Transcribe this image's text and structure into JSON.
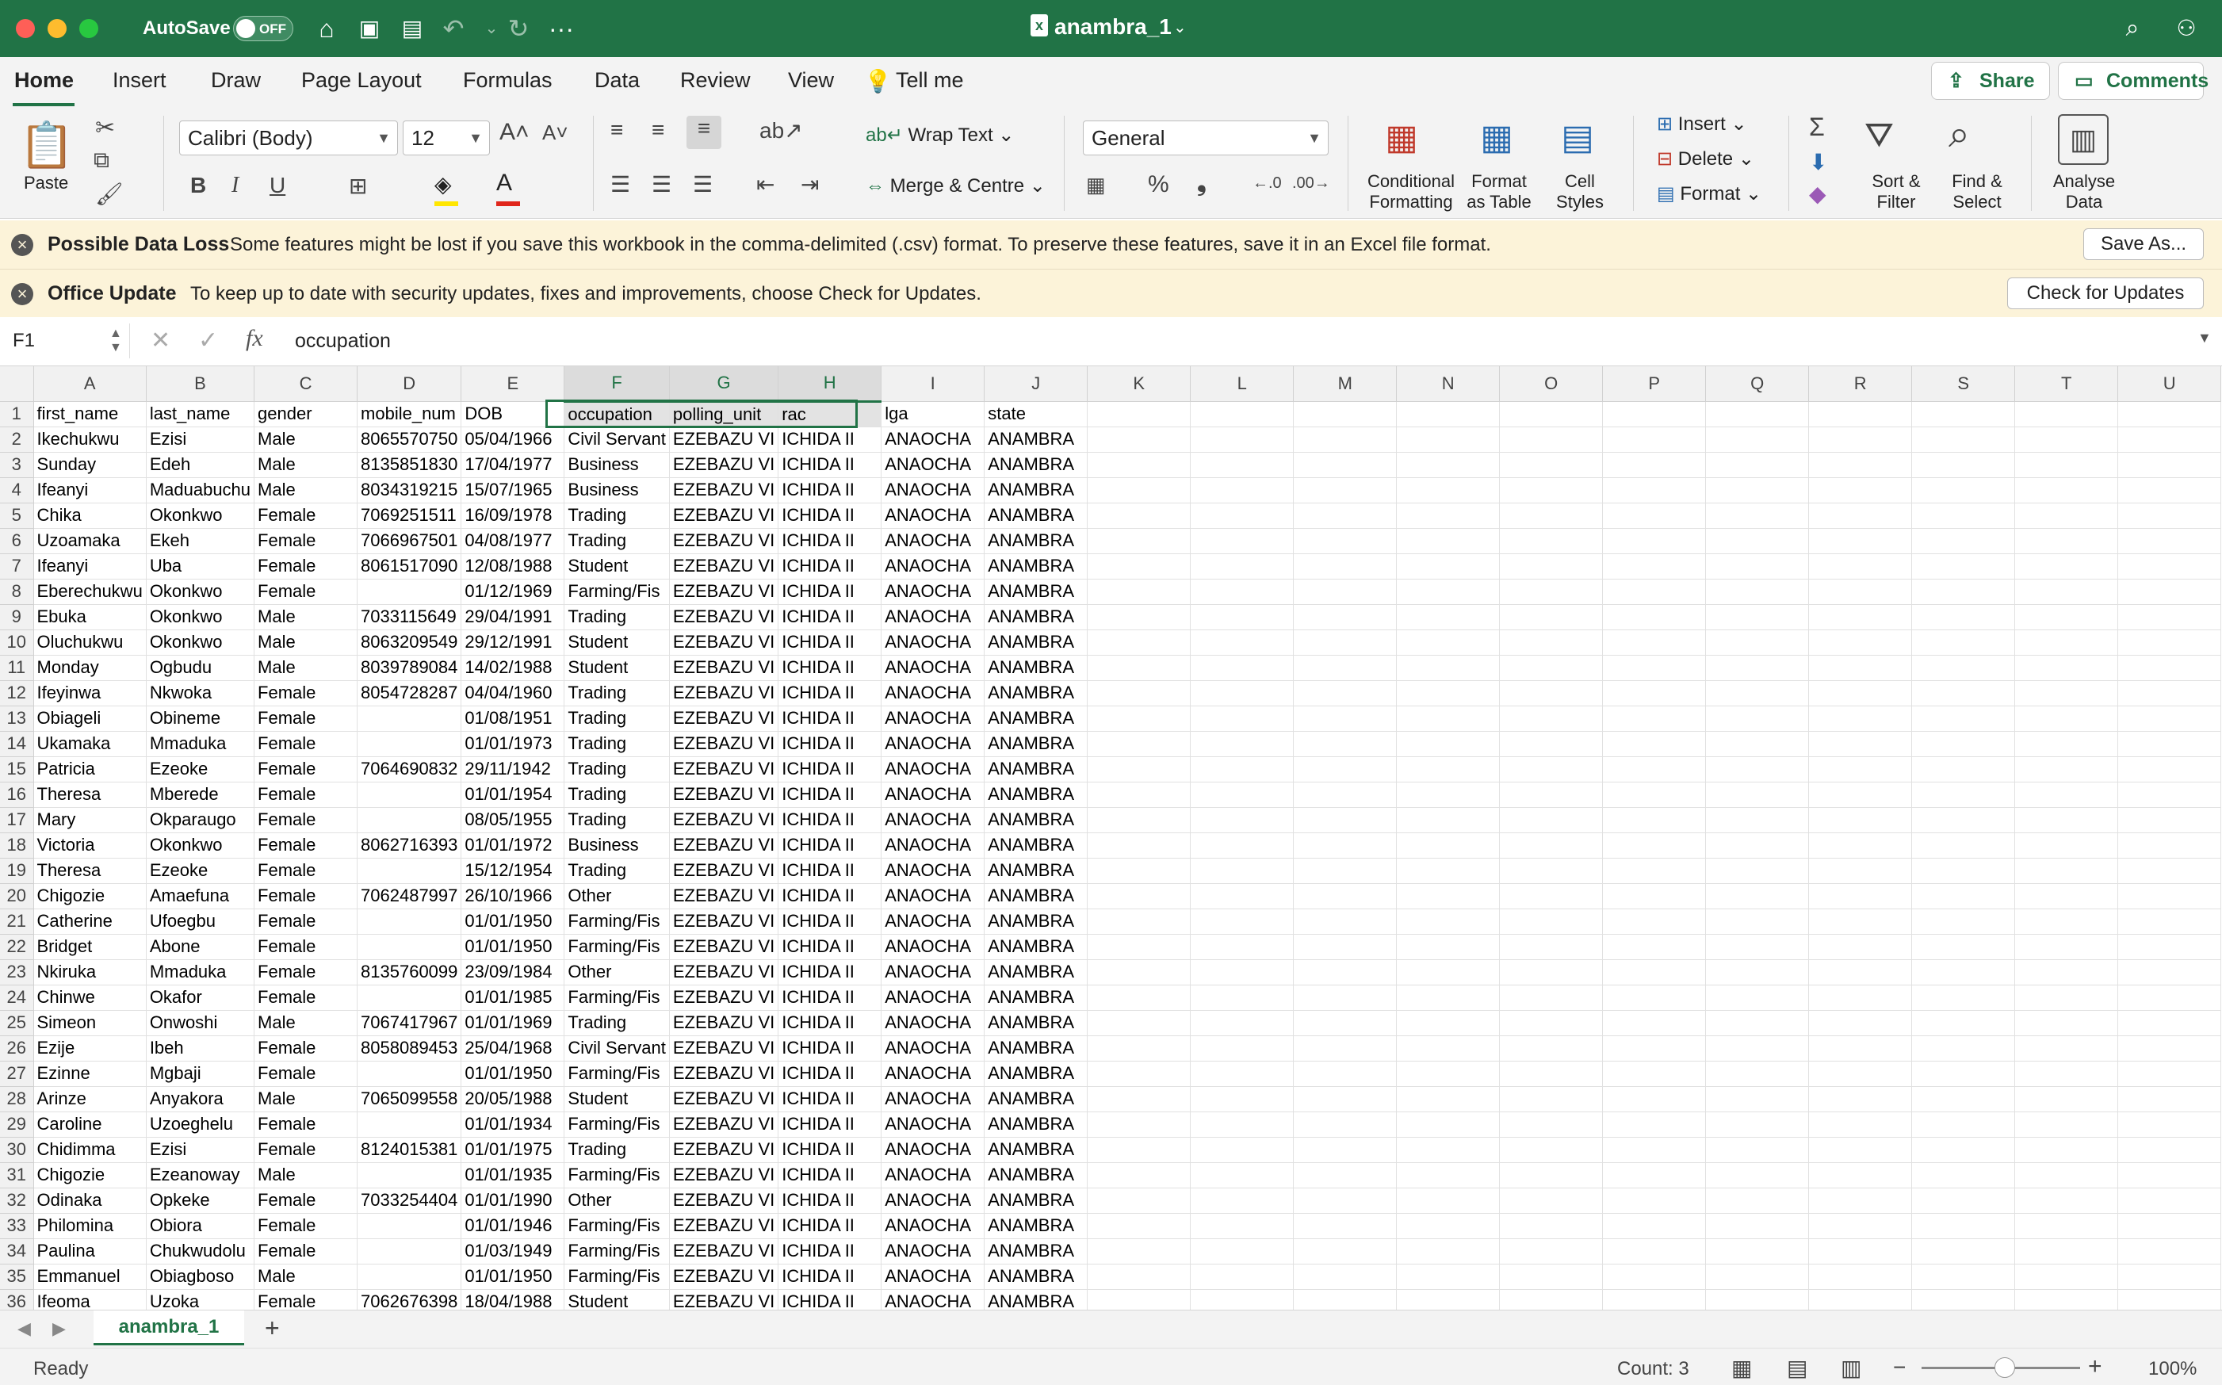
{
  "titlebar": {
    "autosave_label": "AutoSave",
    "autosave_state": "OFF",
    "doc_title": "anambra_1"
  },
  "tabs": [
    "Home",
    "Insert",
    "Draw",
    "Page Layout",
    "Formulas",
    "Data",
    "Review",
    "View"
  ],
  "tell_me": "Tell me",
  "share_label": "Share",
  "comments_label": "Comments",
  "ribbon": {
    "paste": "Paste",
    "font_name": "Calibri (Body)",
    "font_size": "12",
    "wrap_text": "Wrap Text",
    "merge_centre": "Merge & Centre",
    "number_format": "General",
    "conditional_formatting_1": "Conditional",
    "conditional_formatting_2": "Formatting",
    "format_as_table_1": "Format",
    "format_as_table_2": "as Table",
    "cell_styles_1": "Cell",
    "cell_styles_2": "Styles",
    "insert": "Insert",
    "delete": "Delete",
    "format": "Format",
    "sort_filter_1": "Sort &",
    "sort_filter_2": "Filter",
    "find_select_1": "Find &",
    "find_select_2": "Select",
    "analyse_1": "Analyse",
    "analyse_2": "Data"
  },
  "notices": {
    "data_loss_title": "Possible Data Loss",
    "data_loss_msg": "Some features might be lost if you save this workbook in the comma-delimited (.csv) format. To preserve these features, save it in an Excel file format.",
    "save_as": "Save As...",
    "update_title": "Office Update",
    "update_msg": "To keep up to date with security updates, fixes and improvements, choose Check for Updates.",
    "check_updates": "Check for Updates"
  },
  "formula_bar": {
    "name_box": "F1",
    "fx": "fx",
    "content": "occupation"
  },
  "columns": [
    "A",
    "B",
    "C",
    "D",
    "E",
    "F",
    "G",
    "H",
    "I",
    "J",
    "K",
    "L",
    "M",
    "N",
    "O",
    "P",
    "Q",
    "R",
    "S",
    "T",
    "U"
  ],
  "rows": [
    [
      "first_name",
      "last_name",
      "gender",
      "mobile_num",
      "DOB",
      "occupation",
      "polling_unit",
      "rac",
      "lga",
      "state"
    ],
    [
      "Ikechukwu",
      "Ezisi",
      "Male",
      "8065570750",
      "05/04/1966",
      "Civil Servant",
      "EZEBAZU VI",
      "ICHIDA II",
      "ANAOCHA",
      "ANAMBRA"
    ],
    [
      "Sunday",
      "Edeh",
      "Male",
      "8135851830",
      "17/04/1977",
      "Business",
      "EZEBAZU VI",
      "ICHIDA II",
      "ANAOCHA",
      "ANAMBRA"
    ],
    [
      "Ifeanyi",
      "Maduabuchu",
      "Male",
      "8034319215",
      "15/07/1965",
      "Business",
      "EZEBAZU VI",
      "ICHIDA II",
      "ANAOCHA",
      "ANAMBRA"
    ],
    [
      "Chika",
      "Okonkwo",
      "Female",
      "7069251511",
      "16/09/1978",
      "Trading",
      "EZEBAZU VI",
      "ICHIDA II",
      "ANAOCHA",
      "ANAMBRA"
    ],
    [
      "Uzoamaka",
      "Ekeh",
      "Female",
      "7066967501",
      "04/08/1977",
      "Trading",
      "EZEBAZU VI",
      "ICHIDA II",
      "ANAOCHA",
      "ANAMBRA"
    ],
    [
      "Ifeanyi",
      "Uba",
      "Female",
      "8061517090",
      "12/08/1988",
      "Student",
      "EZEBAZU VI",
      "ICHIDA II",
      "ANAOCHA",
      "ANAMBRA"
    ],
    [
      "Eberechukwu",
      "Okonkwo",
      "Female",
      "",
      "01/12/1969",
      "Farming/Fis",
      "EZEBAZU VI",
      "ICHIDA II",
      "ANAOCHA",
      "ANAMBRA"
    ],
    [
      "Ebuka",
      "Okonkwo",
      "Male",
      "7033115649",
      "29/04/1991",
      "Trading",
      "EZEBAZU VI",
      "ICHIDA II",
      "ANAOCHA",
      "ANAMBRA"
    ],
    [
      "Oluchukwu",
      "Okonkwo",
      "Male",
      "8063209549",
      "29/12/1991",
      "Student",
      "EZEBAZU VI",
      "ICHIDA II",
      "ANAOCHA",
      "ANAMBRA"
    ],
    [
      "Monday",
      "Ogbudu",
      "Male",
      "8039789084",
      "14/02/1988",
      "Student",
      "EZEBAZU VI",
      "ICHIDA II",
      "ANAOCHA",
      "ANAMBRA"
    ],
    [
      "Ifeyinwa",
      "Nkwoka",
      "Female",
      "8054728287",
      "04/04/1960",
      "Trading",
      "EZEBAZU VI",
      "ICHIDA II",
      "ANAOCHA",
      "ANAMBRA"
    ],
    [
      "Obiageli",
      "Obineme",
      "Female",
      "",
      "01/08/1951",
      "Trading",
      "EZEBAZU VI",
      "ICHIDA II",
      "ANAOCHA",
      "ANAMBRA"
    ],
    [
      "Ukamaka",
      "Mmaduka",
      "Female",
      "",
      "01/01/1973",
      "Trading",
      "EZEBAZU VI",
      "ICHIDA II",
      "ANAOCHA",
      "ANAMBRA"
    ],
    [
      "Patricia",
      "Ezeoke",
      "Female",
      "7064690832",
      "29/11/1942",
      "Trading",
      "EZEBAZU VI",
      "ICHIDA II",
      "ANAOCHA",
      "ANAMBRA"
    ],
    [
      "Theresa",
      "Mberede",
      "Female",
      "",
      "01/01/1954",
      "Trading",
      "EZEBAZU VI",
      "ICHIDA II",
      "ANAOCHA",
      "ANAMBRA"
    ],
    [
      "Mary",
      "Okparaugo",
      "Female",
      "",
      "08/05/1955",
      "Trading",
      "EZEBAZU VI",
      "ICHIDA II",
      "ANAOCHA",
      "ANAMBRA"
    ],
    [
      "Victoria",
      "Okonkwo",
      "Female",
      "8062716393",
      "01/01/1972",
      "Business",
      "EZEBAZU VI",
      "ICHIDA II",
      "ANAOCHA",
      "ANAMBRA"
    ],
    [
      "Theresa",
      "Ezeoke",
      "Female",
      "",
      "15/12/1954",
      "Trading",
      "EZEBAZU VI",
      "ICHIDA II",
      "ANAOCHA",
      "ANAMBRA"
    ],
    [
      "Chigozie",
      "Amaefuna",
      "Female",
      "7062487997",
      "26/10/1966",
      "Other",
      "EZEBAZU VI",
      "ICHIDA II",
      "ANAOCHA",
      "ANAMBRA"
    ],
    [
      "Catherine",
      "Ufoegbu",
      "Female",
      "",
      "01/01/1950",
      "Farming/Fis",
      "EZEBAZU VI",
      "ICHIDA II",
      "ANAOCHA",
      "ANAMBRA"
    ],
    [
      "Bridget",
      "Abone",
      "Female",
      "",
      "01/01/1950",
      "Farming/Fis",
      "EZEBAZU VI",
      "ICHIDA II",
      "ANAOCHA",
      "ANAMBRA"
    ],
    [
      "Nkiruka",
      "Mmaduka",
      "Female",
      "8135760099",
      "23/09/1984",
      "Other",
      "EZEBAZU VI",
      "ICHIDA II",
      "ANAOCHA",
      "ANAMBRA"
    ],
    [
      "Chinwe",
      "Okafor",
      "Female",
      "",
      "01/01/1985",
      "Farming/Fis",
      "EZEBAZU VI",
      "ICHIDA II",
      "ANAOCHA",
      "ANAMBRA"
    ],
    [
      "Simeon",
      "Onwoshi",
      "Male",
      "7067417967",
      "01/01/1969",
      "Trading",
      "EZEBAZU VI",
      "ICHIDA II",
      "ANAOCHA",
      "ANAMBRA"
    ],
    [
      "Ezije",
      "Ibeh",
      "Female",
      "8058089453",
      "25/04/1968",
      "Civil Servant",
      "EZEBAZU VI",
      "ICHIDA II",
      "ANAOCHA",
      "ANAMBRA"
    ],
    [
      "Ezinne",
      "Mgbaji",
      "Female",
      "",
      "01/01/1950",
      "Farming/Fis",
      "EZEBAZU VI",
      "ICHIDA II",
      "ANAOCHA",
      "ANAMBRA"
    ],
    [
      "Arinze",
      "Anyakora",
      "Male",
      "7065099558",
      "20/05/1988",
      "Student",
      "EZEBAZU VI",
      "ICHIDA II",
      "ANAOCHA",
      "ANAMBRA"
    ],
    [
      "Caroline",
      "Uzoeghelu",
      "Female",
      "",
      "01/01/1934",
      "Farming/Fis",
      "EZEBAZU VI",
      "ICHIDA II",
      "ANAOCHA",
      "ANAMBRA"
    ],
    [
      "Chidimma",
      "Ezisi",
      "Female",
      "8124015381",
      "01/01/1975",
      "Trading",
      "EZEBAZU VI",
      "ICHIDA II",
      "ANAOCHA",
      "ANAMBRA"
    ],
    [
      "Chigozie",
      "Ezeanoway",
      "Male",
      "",
      "01/01/1935",
      "Farming/Fis",
      "EZEBAZU VI",
      "ICHIDA II",
      "ANAOCHA",
      "ANAMBRA"
    ],
    [
      "Odinaka",
      "Opkeke",
      "Female",
      "7033254404",
      "01/01/1990",
      "Other",
      "EZEBAZU VI",
      "ICHIDA II",
      "ANAOCHA",
      "ANAMBRA"
    ],
    [
      "Philomina",
      "Obiora",
      "Female",
      "",
      "01/01/1946",
      "Farming/Fis",
      "EZEBAZU VI",
      "ICHIDA II",
      "ANAOCHA",
      "ANAMBRA"
    ],
    [
      "Paulina",
      "Chukwudolu",
      "Female",
      "",
      "01/03/1949",
      "Farming/Fis",
      "EZEBAZU VI",
      "ICHIDA II",
      "ANAOCHA",
      "ANAMBRA"
    ],
    [
      "Emmanuel",
      "Obiagboso",
      "Male",
      "",
      "01/01/1950",
      "Farming/Fis",
      "EZEBAZU VI",
      "ICHIDA II",
      "ANAOCHA",
      "ANAMBRA"
    ],
    [
      "Ifeoma",
      "Uzoka",
      "Female",
      "7062676398",
      "18/04/1988",
      "Student",
      "EZEBAZU VI",
      "ICHIDA II",
      "ANAOCHA",
      "ANAMBRA"
    ]
  ],
  "sheet_tab": "anambra_1",
  "status": {
    "ready": "Ready",
    "count": "Count: 3",
    "zoom": "100%"
  }
}
